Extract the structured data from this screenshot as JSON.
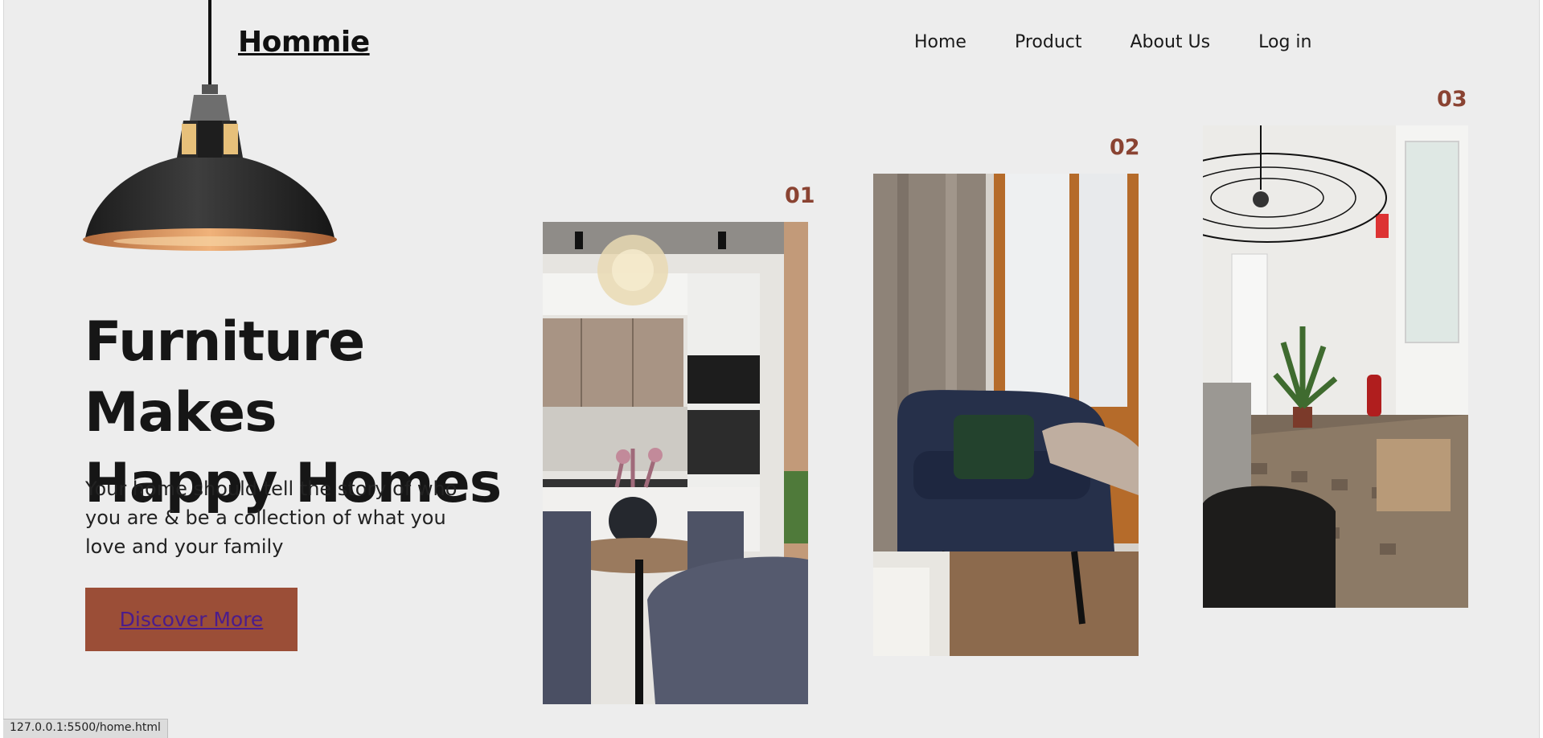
{
  "brand": "Hommie",
  "nav": {
    "home": "Home",
    "product": "Product",
    "about": "About Us",
    "login": "Log in"
  },
  "hero": {
    "line1": "Furniture Makes",
    "line2": "Happy Homes",
    "subtitle": "Your home should tell the story of who you are & be a collection of what you love and your family",
    "cta": "Discover More"
  },
  "gallery": [
    {
      "number": "01",
      "alt": "Modern kitchen with glass pendant lamp and round dining table"
    },
    {
      "number": "02",
      "alt": "Navy armchair with green pillow by tall window"
    },
    {
      "number": "03",
      "alt": "Hallway with wire pendant lamp, palm plant and tufted sofa"
    }
  ],
  "status_url": "127.0.0.1:5500/home.html",
  "colors": {
    "background": "#ededed",
    "accent": "#9b4e37",
    "numbers": "#8a4332",
    "link": "#4b1c8c"
  }
}
